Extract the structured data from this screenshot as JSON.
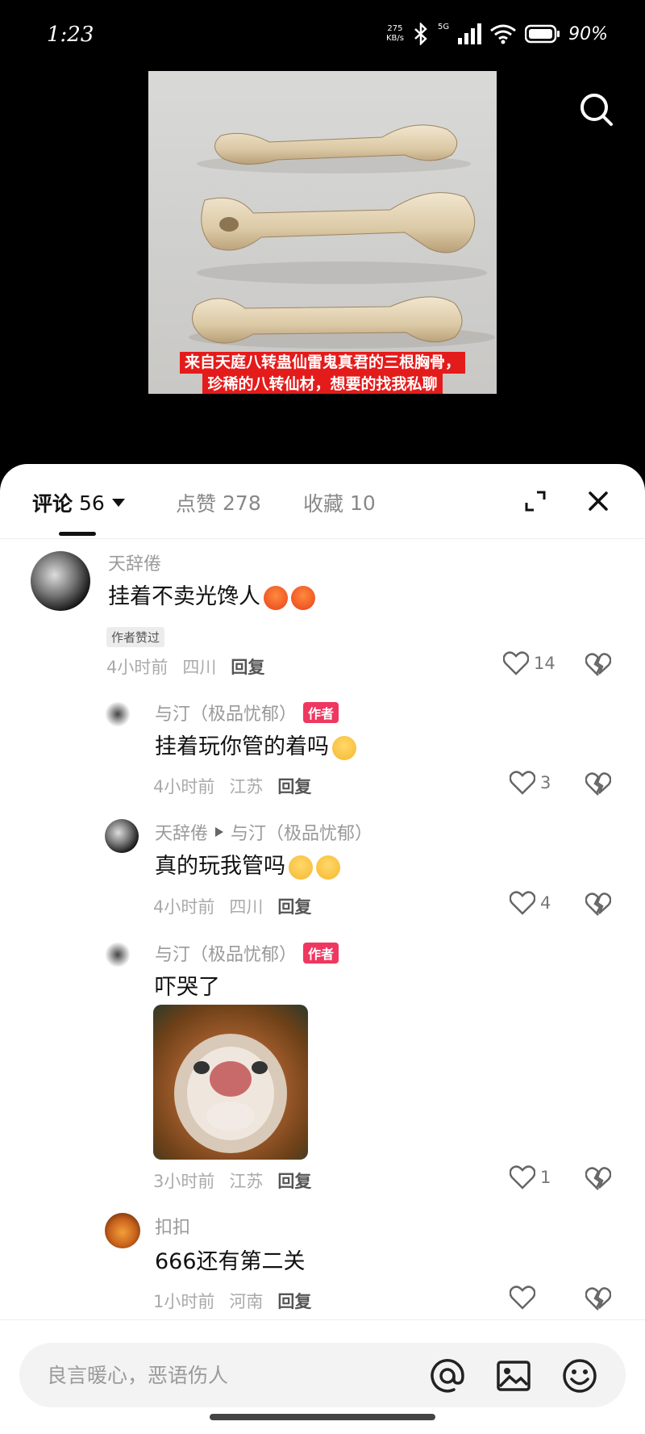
{
  "status_bar": {
    "time": "1:23",
    "net_speed_value": "275",
    "net_speed_unit": "KB/s",
    "network": "5G",
    "battery": "90%"
  },
  "post": {
    "caption_line1": "来自天庭八转蛊仙雷鬼真君的三根胸骨，",
    "caption_line2": "珍稀的八转仙材，想要的找我私聊"
  },
  "tabs": [
    {
      "label": "评论",
      "count": "56"
    },
    {
      "label": "点赞",
      "count": "278"
    },
    {
      "label": "收藏",
      "count": "10"
    }
  ],
  "comments": [
    {
      "user": "天辞倦",
      "text": "挂着不卖光馋人",
      "author_liked": "作者赞过",
      "time": "4小时前",
      "location": "四川",
      "reply": "回复",
      "likes": "14"
    },
    {
      "user": "与汀（极品忧郁）",
      "badge": "作者",
      "text": "挂着玩你管的着吗",
      "time": "4小时前",
      "location": "江苏",
      "reply": "回复",
      "likes": "3"
    },
    {
      "user": "天辞倦",
      "reply_to": "与汀（极品忧郁）",
      "text": "真的玩我管吗",
      "time": "4小时前",
      "location": "四川",
      "reply": "回复",
      "likes": "4"
    },
    {
      "user": "与汀（极品忧郁）",
      "badge": "作者",
      "text": "吓哭了",
      "time": "3小时前",
      "location": "江苏",
      "reply": "回复",
      "likes": "1"
    },
    {
      "user": "扣扣",
      "text": "666还有第二关",
      "time": "1小时前",
      "location": "河南",
      "reply": "回复",
      "likes": ""
    }
  ],
  "input": {
    "placeholder": "良言暖心，恶语伤人"
  },
  "icons": [
    "search-icon",
    "expand-icon",
    "close-icon",
    "heart-icon",
    "broken-heart-icon",
    "at-icon",
    "image-icon",
    "emoji-icon"
  ],
  "colors": {
    "author_badge": "#ee3860",
    "caption_bg": "#e41b1b"
  }
}
